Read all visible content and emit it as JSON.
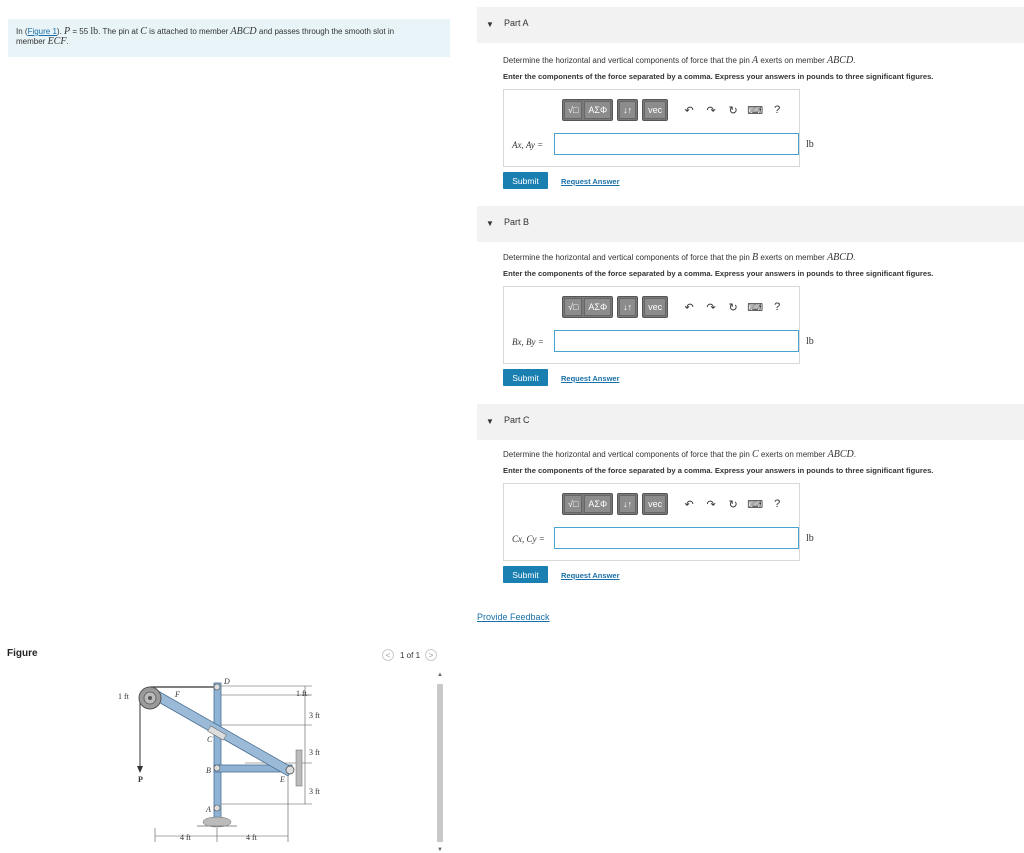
{
  "problem": {
    "prefix": "In (",
    "figure_link": "Figure 1",
    "mid": "). ",
    "P_sym": "P",
    "eq": " = 55 ",
    "unit": "lb",
    "text1": ". The pin at ",
    "C_sym": "C",
    "text2": " is attached to member ",
    "ABCD_sym": "ABCD",
    "text3": " and passes through the smooth slot in",
    "text4": "member ",
    "ECF_sym": "ECF",
    "text5": "."
  },
  "figure": {
    "label": "Figure",
    "pager": "1 of 1",
    "labels": {
      "one_ft_left": "1 ft",
      "one_ft_right": "1 ft",
      "d3ft_1": "3 ft",
      "d3ft_2": "3 ft",
      "d3ft_3": "3 ft",
      "d4ft_1": "4 ft",
      "d4ft_2": "4 ft",
      "P": "P",
      "A": "A",
      "B": "B",
      "C": "C",
      "D": "D",
      "E": "E",
      "F": "F"
    }
  },
  "parts": [
    {
      "title": "Part A",
      "q_pre": "Determine the horizontal and vertical components of force that the pin ",
      "q_sym": "A",
      "q_mid": " exerts on member ",
      "q_member": "ABCD",
      "q_end": ".",
      "instruction": "Enter the components of the force separated by a comma. Express your answers in pounds to three significant figures.",
      "answer_label": "Ax, Ay =",
      "unit": "lb",
      "submit": "Submit",
      "request": "Request Answer"
    },
    {
      "title": "Part B",
      "q_pre": "Determine the horizontal and vertical components of force that the pin ",
      "q_sym": "B",
      "q_mid": " exerts on member ",
      "q_member": "ABCD",
      "q_end": ".",
      "instruction": "Enter the components of the force separated by a comma. Express your answers in pounds to three significant figures.",
      "answer_label": "Bx, By =",
      "unit": "lb",
      "submit": "Submit",
      "request": "Request Answer"
    },
    {
      "title": "Part C",
      "q_pre": "Determine the horizontal and vertical components of force that the pin ",
      "q_sym": "C",
      "q_mid": " exerts on member ",
      "q_member": "ABCD",
      "q_end": ".",
      "instruction": "Enter the components of the force separated by a comma. Express your answers in pounds to three significant figures.",
      "answer_label": "Cx, Cy =",
      "unit": "lb",
      "submit": "Submit",
      "request": "Request Answer"
    }
  ],
  "toolbar": {
    "templates": "√□",
    "greek": "ΑΣΦ",
    "arrows": "↓↑",
    "vec": "vec",
    "undo_icon": "undo-icon",
    "redo_icon": "redo-icon",
    "reset_icon": "reset-icon",
    "keyboard_icon": "keyboard-icon",
    "help": "?"
  },
  "feedback": "Provide Feedback"
}
